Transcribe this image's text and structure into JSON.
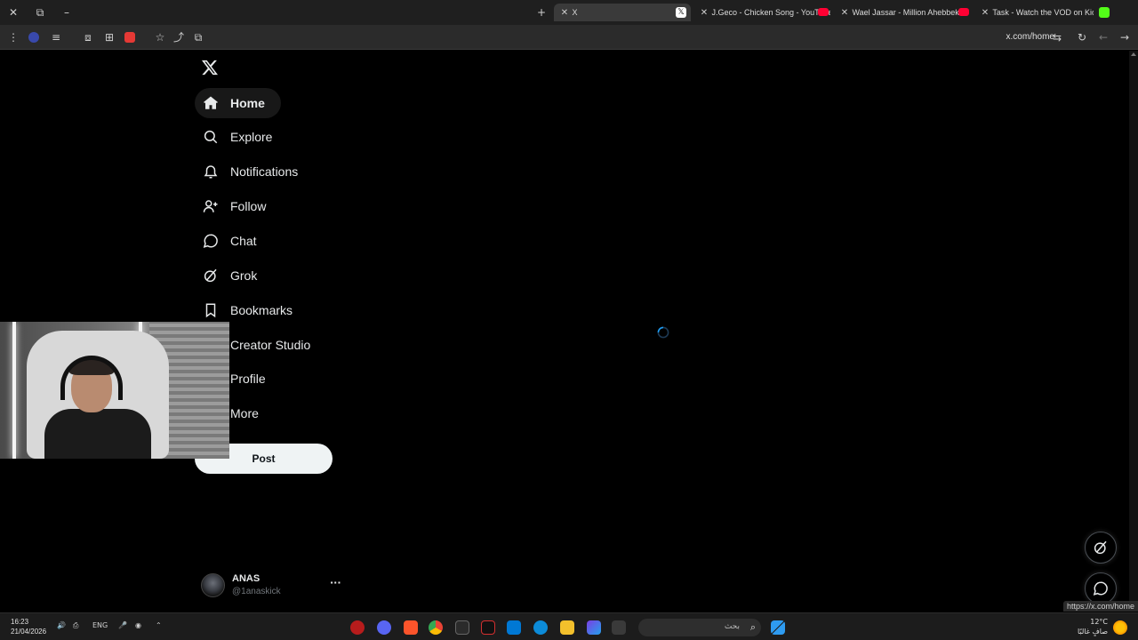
{
  "browser": {
    "tabs": [
      {
        "label": "X",
        "active": true
      },
      {
        "label": "J.Geco - Chicken Song - YouTube",
        "active": false
      },
      {
        "label": "Wael Jassar - Million Ahebbek",
        "active": false
      },
      {
        "label": "Task - Watch the VOD on Kick",
        "active": false
      }
    ],
    "url": "x.com/home",
    "status_url": "https://x.com/home"
  },
  "sidebar": {
    "items": [
      {
        "label": "Home",
        "icon": "home-icon",
        "active": true
      },
      {
        "label": "Explore",
        "icon": "search-icon"
      },
      {
        "label": "Notifications",
        "icon": "bell-icon"
      },
      {
        "label": "Follow",
        "icon": "person-add-icon"
      },
      {
        "label": "Chat",
        "icon": "chat-icon"
      },
      {
        "label": "Grok",
        "icon": "grok-icon"
      },
      {
        "label": "Bookmarks",
        "icon": "bookmark-icon"
      },
      {
        "label": "Creator Studio",
        "icon": "creator-studio-icon"
      },
      {
        "label": "Profile",
        "icon": "profile-icon"
      },
      {
        "label": "More",
        "icon": "more-icon"
      }
    ],
    "post_label": "Post"
  },
  "account": {
    "name": "ANAS",
    "handle": "@1anaskick",
    "more": "···"
  },
  "taskbar": {
    "time": "16:23",
    "date": "21/04/2026",
    "lang": "ENG",
    "search_placeholder": "بحث",
    "temperature": "12°C",
    "weather": "صافٍ غالبًا"
  },
  "colors": {
    "background": "#000000",
    "text": "#e7e9ea",
    "muted": "#71767b",
    "post_button": "#eff3f4"
  }
}
